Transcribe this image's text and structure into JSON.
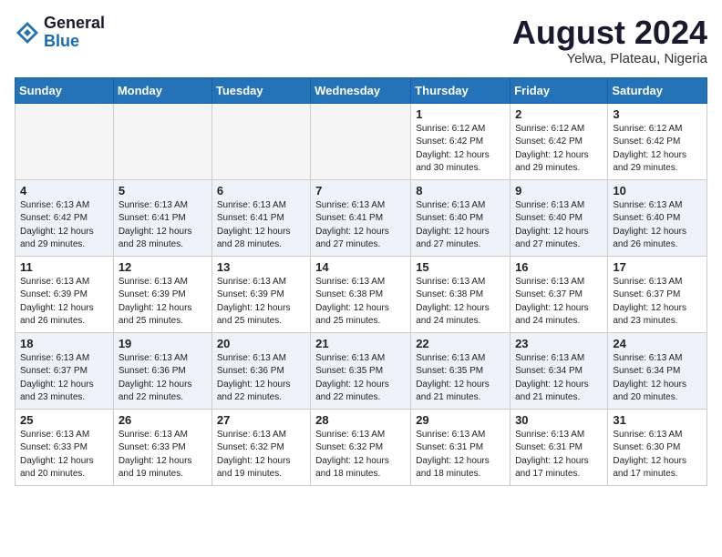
{
  "logo": {
    "general": "General",
    "blue": "Blue"
  },
  "title": "August 2024",
  "subtitle": "Yelwa, Plateau, Nigeria",
  "days_of_week": [
    "Sunday",
    "Monday",
    "Tuesday",
    "Wednesday",
    "Thursday",
    "Friday",
    "Saturday"
  ],
  "weeks": [
    [
      {
        "day": "",
        "info": ""
      },
      {
        "day": "",
        "info": ""
      },
      {
        "day": "",
        "info": ""
      },
      {
        "day": "",
        "info": ""
      },
      {
        "day": "1",
        "info": "Sunrise: 6:12 AM\nSunset: 6:42 PM\nDaylight: 12 hours\nand 30 minutes."
      },
      {
        "day": "2",
        "info": "Sunrise: 6:12 AM\nSunset: 6:42 PM\nDaylight: 12 hours\nand 29 minutes."
      },
      {
        "day": "3",
        "info": "Sunrise: 6:12 AM\nSunset: 6:42 PM\nDaylight: 12 hours\nand 29 minutes."
      }
    ],
    [
      {
        "day": "4",
        "info": "Sunrise: 6:13 AM\nSunset: 6:42 PM\nDaylight: 12 hours\nand 29 minutes."
      },
      {
        "day": "5",
        "info": "Sunrise: 6:13 AM\nSunset: 6:41 PM\nDaylight: 12 hours\nand 28 minutes."
      },
      {
        "day": "6",
        "info": "Sunrise: 6:13 AM\nSunset: 6:41 PM\nDaylight: 12 hours\nand 28 minutes."
      },
      {
        "day": "7",
        "info": "Sunrise: 6:13 AM\nSunset: 6:41 PM\nDaylight: 12 hours\nand 27 minutes."
      },
      {
        "day": "8",
        "info": "Sunrise: 6:13 AM\nSunset: 6:40 PM\nDaylight: 12 hours\nand 27 minutes."
      },
      {
        "day": "9",
        "info": "Sunrise: 6:13 AM\nSunset: 6:40 PM\nDaylight: 12 hours\nand 27 minutes."
      },
      {
        "day": "10",
        "info": "Sunrise: 6:13 AM\nSunset: 6:40 PM\nDaylight: 12 hours\nand 26 minutes."
      }
    ],
    [
      {
        "day": "11",
        "info": "Sunrise: 6:13 AM\nSunset: 6:39 PM\nDaylight: 12 hours\nand 26 minutes."
      },
      {
        "day": "12",
        "info": "Sunrise: 6:13 AM\nSunset: 6:39 PM\nDaylight: 12 hours\nand 25 minutes."
      },
      {
        "day": "13",
        "info": "Sunrise: 6:13 AM\nSunset: 6:39 PM\nDaylight: 12 hours\nand 25 minutes."
      },
      {
        "day": "14",
        "info": "Sunrise: 6:13 AM\nSunset: 6:38 PM\nDaylight: 12 hours\nand 25 minutes."
      },
      {
        "day": "15",
        "info": "Sunrise: 6:13 AM\nSunset: 6:38 PM\nDaylight: 12 hours\nand 24 minutes."
      },
      {
        "day": "16",
        "info": "Sunrise: 6:13 AM\nSunset: 6:37 PM\nDaylight: 12 hours\nand 24 minutes."
      },
      {
        "day": "17",
        "info": "Sunrise: 6:13 AM\nSunset: 6:37 PM\nDaylight: 12 hours\nand 23 minutes."
      }
    ],
    [
      {
        "day": "18",
        "info": "Sunrise: 6:13 AM\nSunset: 6:37 PM\nDaylight: 12 hours\nand 23 minutes."
      },
      {
        "day": "19",
        "info": "Sunrise: 6:13 AM\nSunset: 6:36 PM\nDaylight: 12 hours\nand 22 minutes."
      },
      {
        "day": "20",
        "info": "Sunrise: 6:13 AM\nSunset: 6:36 PM\nDaylight: 12 hours\nand 22 minutes."
      },
      {
        "day": "21",
        "info": "Sunrise: 6:13 AM\nSunset: 6:35 PM\nDaylight: 12 hours\nand 22 minutes."
      },
      {
        "day": "22",
        "info": "Sunrise: 6:13 AM\nSunset: 6:35 PM\nDaylight: 12 hours\nand 21 minutes."
      },
      {
        "day": "23",
        "info": "Sunrise: 6:13 AM\nSunset: 6:34 PM\nDaylight: 12 hours\nand 21 minutes."
      },
      {
        "day": "24",
        "info": "Sunrise: 6:13 AM\nSunset: 6:34 PM\nDaylight: 12 hours\nand 20 minutes."
      }
    ],
    [
      {
        "day": "25",
        "info": "Sunrise: 6:13 AM\nSunset: 6:33 PM\nDaylight: 12 hours\nand 20 minutes."
      },
      {
        "day": "26",
        "info": "Sunrise: 6:13 AM\nSunset: 6:33 PM\nDaylight: 12 hours\nand 19 minutes."
      },
      {
        "day": "27",
        "info": "Sunrise: 6:13 AM\nSunset: 6:32 PM\nDaylight: 12 hours\nand 19 minutes."
      },
      {
        "day": "28",
        "info": "Sunrise: 6:13 AM\nSunset: 6:32 PM\nDaylight: 12 hours\nand 18 minutes."
      },
      {
        "day": "29",
        "info": "Sunrise: 6:13 AM\nSunset: 6:31 PM\nDaylight: 12 hours\nand 18 minutes."
      },
      {
        "day": "30",
        "info": "Sunrise: 6:13 AM\nSunset: 6:31 PM\nDaylight: 12 hours\nand 17 minutes."
      },
      {
        "day": "31",
        "info": "Sunrise: 6:13 AM\nSunset: 6:30 PM\nDaylight: 12 hours\nand 17 minutes."
      }
    ]
  ]
}
